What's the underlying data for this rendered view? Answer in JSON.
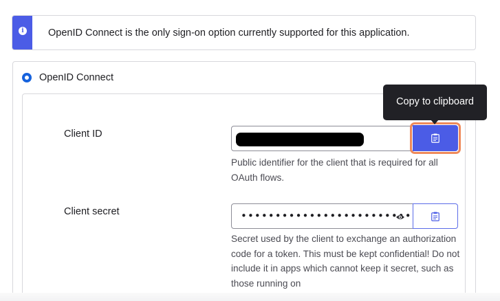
{
  "banner": {
    "message": "OpenID Connect is the only sign-on option currently supported for this application."
  },
  "sign_on": {
    "option_label": "OpenID Connect",
    "selected": true
  },
  "client_id": {
    "label": "Client ID",
    "help": "Public identifier for the client that is required for all OAuth flows."
  },
  "client_secret": {
    "label": "Client secret",
    "masked_value": "••••••••••••••••••••••••••••",
    "help": "Secret used by the client to exchange an authorization code for a token. This must be kept confidential! Do not include it in apps which cannot keep it secret, such as those running on"
  },
  "tooltip": {
    "text": "Copy to clipboard"
  },
  "colors": {
    "accent": "#4b5ce6",
    "radio": "#1662dd",
    "focus": "#ef8a5a",
    "tooltip_bg": "#212126"
  },
  "icons": {
    "info": "info-icon",
    "copy": "clipboard-icon",
    "reveal": "eye-icon"
  }
}
